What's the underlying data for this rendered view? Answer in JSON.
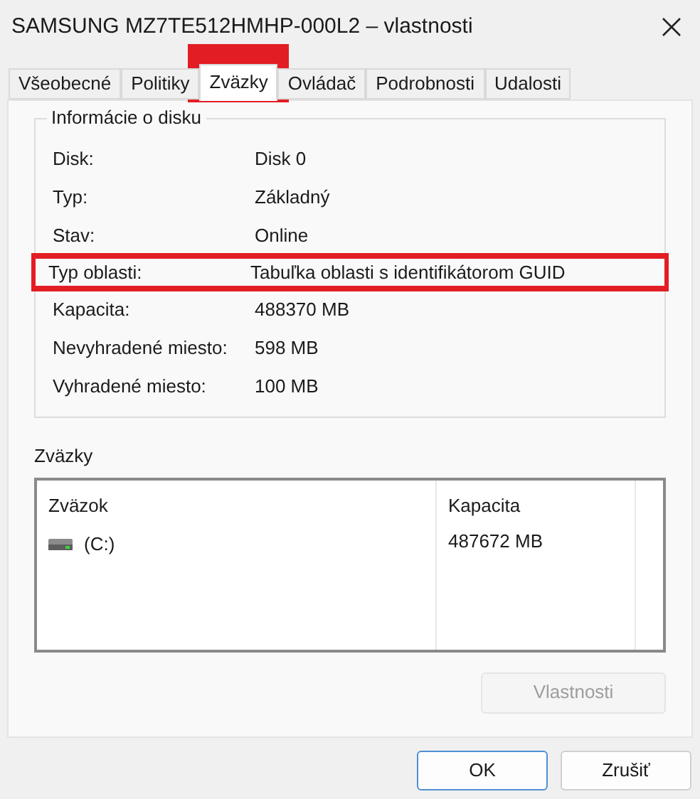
{
  "window": {
    "title": "SAMSUNG MZ7TE512HMHP-000L2 – vlastnosti"
  },
  "tabs": [
    {
      "label": "Všeobecné",
      "selected": false,
      "highlighted": false
    },
    {
      "label": "Politiky",
      "selected": false,
      "highlighted": false
    },
    {
      "label": "Zväzky",
      "selected": true,
      "highlighted": true
    },
    {
      "label": "Ovládač",
      "selected": false,
      "highlighted": false
    },
    {
      "label": "Podrobnosti",
      "selected": false,
      "highlighted": false
    },
    {
      "label": "Udalosti",
      "selected": false,
      "highlighted": false
    }
  ],
  "disk_info": {
    "title": "Informácie o disku",
    "rows": [
      {
        "label": "Disk:",
        "value": "Disk 0",
        "highlighted": false
      },
      {
        "label": "Typ:",
        "value": "Základný",
        "highlighted": false
      },
      {
        "label": "Stav:",
        "value": "Online",
        "highlighted": false
      },
      {
        "label": "Typ oblasti:",
        "value": "Tabuľka oblasti s identifikátorom GUID",
        "highlighted": true
      },
      {
        "label": "Kapacita:",
        "value": "488370 MB",
        "highlighted": false
      },
      {
        "label": "Nevyhradené miesto:",
        "value": "598 MB",
        "highlighted": false
      },
      {
        "label": "Vyhradené miesto:",
        "value": "100 MB",
        "highlighted": false
      }
    ]
  },
  "volumes": {
    "title": "Zväzky",
    "columns": [
      "Zväzok",
      "Kapacita"
    ],
    "rows": [
      {
        "name": "(C:)",
        "capacity": "487672 MB"
      }
    ],
    "button": {
      "label": "Vlastnosti",
      "disabled": true
    }
  },
  "buttons": [
    "OK",
    "Zrušiť"
  ]
}
